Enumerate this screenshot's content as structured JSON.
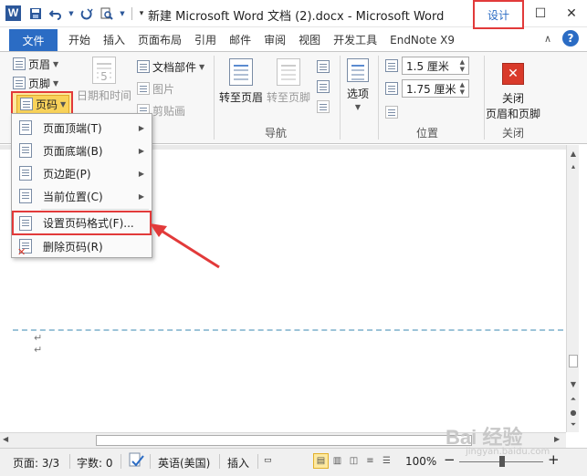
{
  "titlebar": {
    "logo": "W",
    "title": "新建 Microsoft Word 文档 (2).docx - Microsoft Word",
    "qat_icons": [
      "save-icon",
      "undo-icon",
      "redo-icon",
      "print-preview-icon"
    ],
    "minimize": "—",
    "maximize": "☐",
    "close": "✕"
  },
  "tabs": {
    "file": "文件",
    "items": [
      "开始",
      "插入",
      "页面布局",
      "引用",
      "邮件",
      "审阅",
      "视图",
      "开发工具",
      "EndNote X9"
    ],
    "design": "设计",
    "ribbon_collapse": "∧",
    "help": "?"
  },
  "ribbon": {
    "header": "页眉",
    "footer": "页脚",
    "page_number": "页码",
    "date_time": "日期和时间",
    "doc_parts": "文档部件",
    "picture": "图片",
    "clip_art": "剪贴画",
    "goto_header": "转至页眉",
    "goto_footer": "转至页脚",
    "nav_group": "导航",
    "options": "选项",
    "header_from_top": "1.5 厘米",
    "footer_from_bottom": "1.75 厘米",
    "position_group": "位置",
    "close_label_1": "关闭",
    "close_label_2": "页眉和页脚",
    "close_group": "关闭",
    "date_icon_digit": "5"
  },
  "menu": {
    "items": [
      {
        "label": "页面顶端(T)",
        "has_submenu": true
      },
      {
        "label": "页面底端(B)",
        "has_submenu": true
      },
      {
        "label": "页边距(P)",
        "has_submenu": true
      },
      {
        "label": "当前位置(C)",
        "has_submenu": true
      },
      {
        "label": "设置页码格式(F)...",
        "has_submenu": false
      },
      {
        "label": "删除页码(R)",
        "has_submenu": false
      }
    ]
  },
  "document": {
    "para_mark_1": "↵",
    "para_mark_2": "↵"
  },
  "statusbar": {
    "page": "页面: 3/3",
    "words": "字数: 0",
    "language": "英语(美国)",
    "insert_mode": "插入",
    "zoom": "100%",
    "zoom_minus": "−",
    "zoom_plus": "+"
  },
  "watermark": {
    "text": "Bai 经验",
    "sub": "jingyan.baidu.com"
  },
  "colors": {
    "accent_blue": "#2b6cc4",
    "annotation_red": "#e23a3a",
    "highlight_yellow": "#fde9a0"
  }
}
